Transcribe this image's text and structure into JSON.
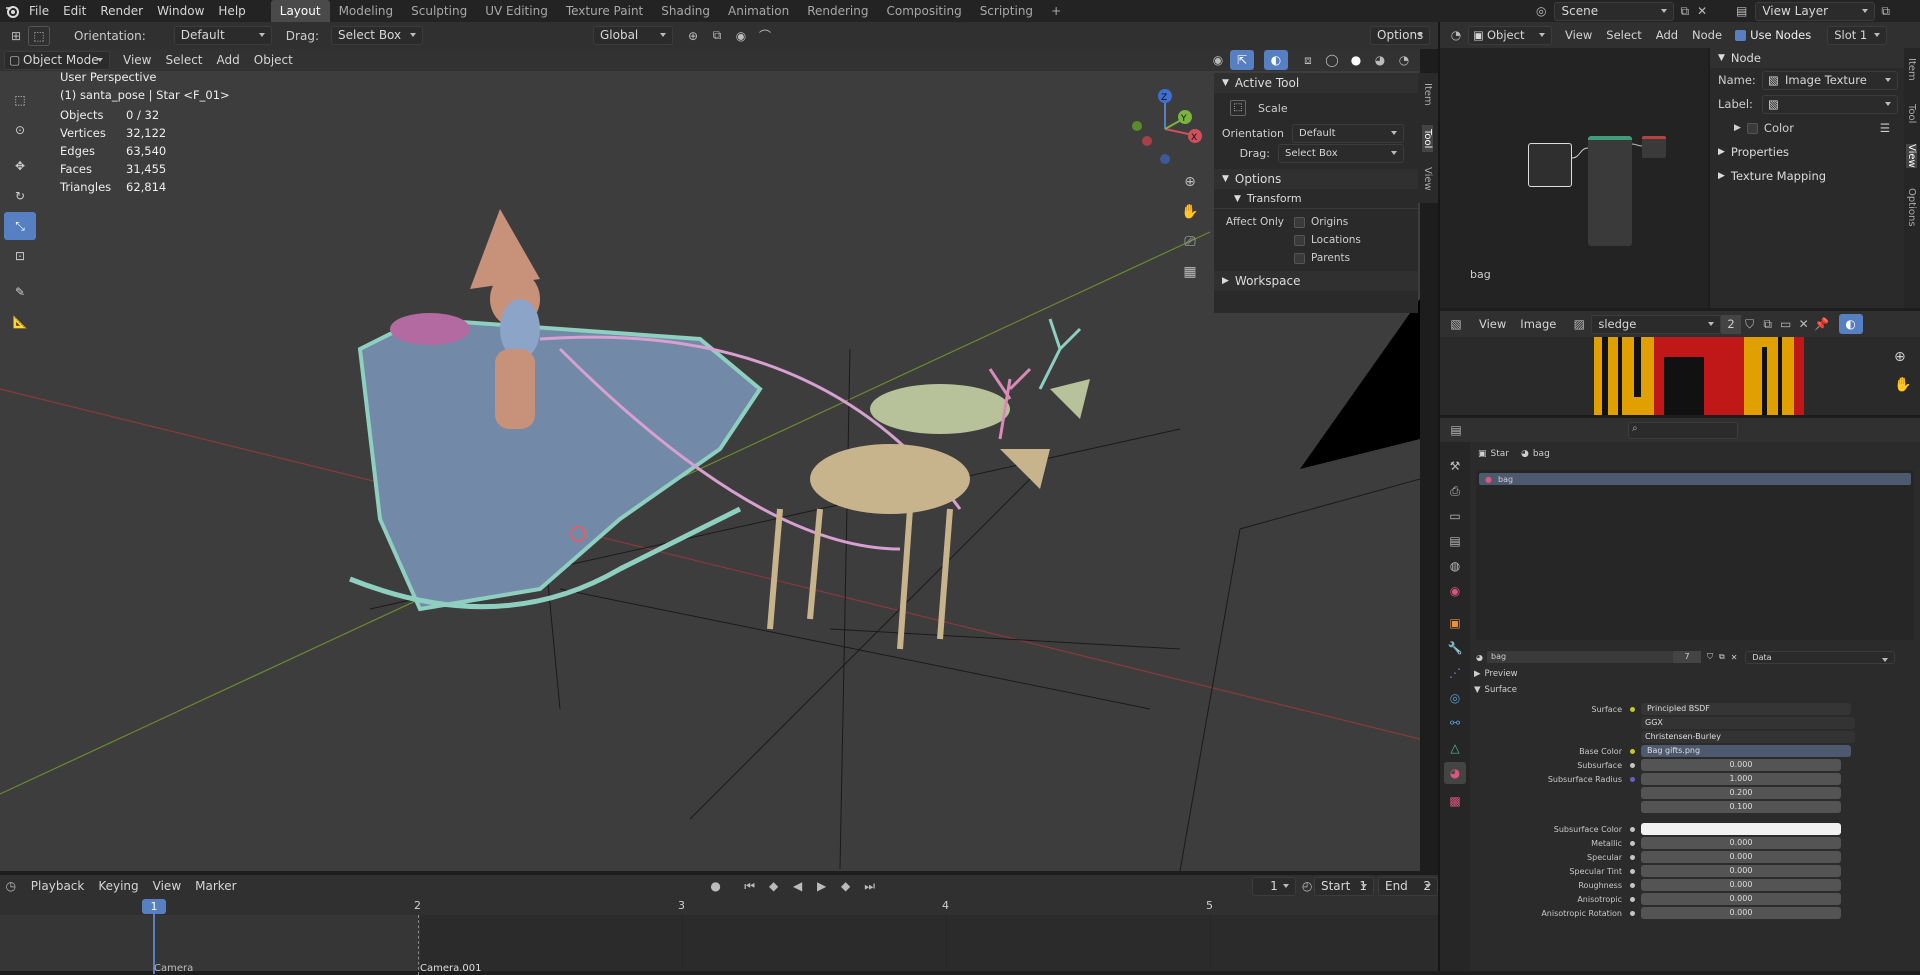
{
  "topbar": {
    "menus": [
      "File",
      "Edit",
      "Render",
      "Window",
      "Help"
    ],
    "workspace_tabs": [
      "Layout",
      "Modeling",
      "Sculpting",
      "UV Editing",
      "Texture Paint",
      "Shading",
      "Animation",
      "Rendering",
      "Compositing",
      "Scripting"
    ],
    "active_tab": "Layout",
    "add_tab": "+",
    "scene": "Scene",
    "view_layer": "View Layer"
  },
  "tool_header": {
    "orientation_label": "Orientation:",
    "orientation_value": "Default",
    "drag_label": "Drag:",
    "drag_value": "Select Box",
    "transform_orientation": "Global",
    "options": "Options"
  },
  "viewport_header": {
    "mode": "Object Mode",
    "menus": [
      "View",
      "Select",
      "Add",
      "Object"
    ]
  },
  "viewport": {
    "perspective": "User Perspective",
    "object_info": "(1) santa_pose | Star <F_01>",
    "stats": [
      {
        "label": "Objects",
        "value": "0 / 32"
      },
      {
        "label": "Vertices",
        "value": "32,122"
      },
      {
        "label": "Edges",
        "value": "63,540"
      },
      {
        "label": "Faces",
        "value": "31,455"
      },
      {
        "label": "Triangles",
        "value": "62,814"
      }
    ],
    "gizmo": {
      "x": "X",
      "y": "Y",
      "z": "Z"
    }
  },
  "n_panel": {
    "tabs": [
      "Item",
      "Tool",
      "View"
    ],
    "active_tool_title": "Active Tool",
    "tool_name": "Scale",
    "orientation_label": "Orientation",
    "orientation_value": "Default",
    "drag_label": "Drag:",
    "drag_value": "Select Box",
    "options_title": "Options",
    "transform_title": "Transform",
    "affect_only": "Affect Only",
    "affect_items": [
      "Origins",
      "Locations",
      "Parents"
    ],
    "workspace_title": "Workspace"
  },
  "node_editor": {
    "editor_type": "Object",
    "menus": [
      "View",
      "Select",
      "Add",
      "Node"
    ],
    "use_nodes": "Use Nodes",
    "slot": "Slot 1",
    "material_name": "bag",
    "node_panel_title": "Node",
    "name_label": "Name:",
    "name_value": "Image Texture",
    "label_label": "Label:",
    "color_label": "Color",
    "properties": "Properties",
    "texture_mapping": "Texture Mapping",
    "side_tabs": [
      "Item",
      "Tool",
      "View",
      "Options"
    ]
  },
  "image_editor": {
    "menus": [
      "View",
      "Image"
    ],
    "image_name": "sledge",
    "users": "2"
  },
  "outliner": {
    "search_placeholder": ""
  },
  "properties": {
    "breadcrumb": [
      "Star",
      "bag"
    ],
    "slot_item": "bag",
    "material_field": "bag",
    "material_users": "7",
    "data_dropdown": "Data",
    "preview": "Preview",
    "surface": "Surface",
    "rows": [
      {
        "label": "Surface",
        "value": "Principled BSDF",
        "kind": "link"
      },
      {
        "label": "",
        "value": "GGX",
        "kind": "drop"
      },
      {
        "label": "",
        "value": "Christensen-Burley",
        "kind": "drop"
      },
      {
        "label": "Base Color",
        "value": "Bag gifts.png",
        "kind": "link"
      },
      {
        "label": "Subsurface",
        "value": "0.000",
        "kind": "num"
      },
      {
        "label": "Subsurface Radius",
        "value": "1.000",
        "kind": "num"
      },
      {
        "label": "",
        "value": "0.200",
        "kind": "num"
      },
      {
        "label": "",
        "value": "0.100",
        "kind": "num"
      },
      {
        "label": "Subsurface Color",
        "value": "",
        "kind": "color"
      },
      {
        "label": "Metallic",
        "value": "0.000",
        "kind": "num"
      },
      {
        "label": "Specular",
        "value": "0.000",
        "kind": "num"
      },
      {
        "label": "Specular Tint",
        "value": "0.000",
        "kind": "num"
      },
      {
        "label": "Roughness",
        "value": "0.000",
        "kind": "num"
      },
      {
        "label": "Anisotropic",
        "value": "0.000",
        "kind": "num"
      },
      {
        "label": "Anisotropic Rotation",
        "value": "0.000",
        "kind": "num"
      }
    ]
  },
  "timeline": {
    "menus": [
      "Playback",
      "Keying",
      "View",
      "Marker"
    ],
    "current_frame": "1",
    "start_label": "Start",
    "start_value": "1",
    "end_label": "End",
    "end_value": "2",
    "ruler": [
      "1",
      "2",
      "3",
      "4",
      "5"
    ],
    "markers": [
      "Camera",
      "Camera.001"
    ]
  },
  "colors": {
    "accent": "#5680c2",
    "bg": "#303030",
    "viewport": "#3d3d3d"
  }
}
